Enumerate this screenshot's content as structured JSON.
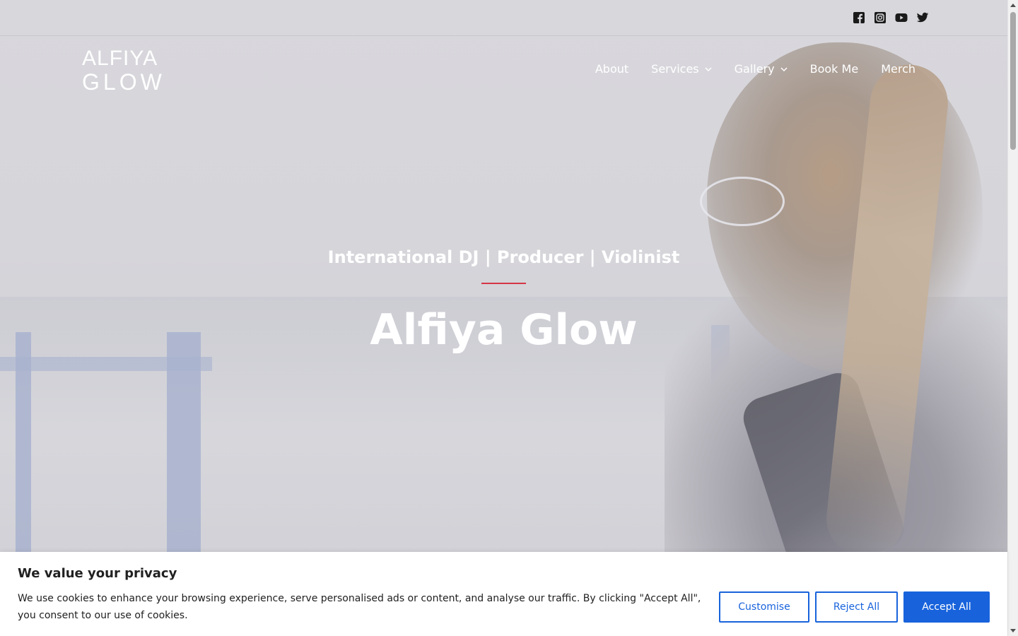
{
  "social": [
    {
      "icon": "facebook-icon"
    },
    {
      "icon": "instagram-icon"
    },
    {
      "icon": "youtube-icon"
    },
    {
      "icon": "twitter-icon"
    }
  ],
  "logo": {
    "line1": "ALFIYA",
    "line2": "GLOW"
  },
  "nav": {
    "items": [
      {
        "label": "About",
        "has_dropdown": false
      },
      {
        "label": "Services",
        "has_dropdown": true
      },
      {
        "label": "Gallery",
        "has_dropdown": true
      },
      {
        "label": "Book Me",
        "has_dropdown": false
      },
      {
        "label": "Merch",
        "has_dropdown": false
      }
    ]
  },
  "hero": {
    "tagline": "International DJ | Producer | Violinist",
    "title": "Alfiya Glow",
    "accent_color": "#d63545"
  },
  "cookie": {
    "title": "We value your privacy",
    "text": "We use cookies to enhance your browsing experience, serve personalised ads or content, and analyse our traffic. By clicking \"Accept All\", you consent to our use of cookies.",
    "customise_label": "Customise",
    "reject_label": "Reject All",
    "accept_label": "Accept All",
    "brand_color": "#1863dc"
  }
}
